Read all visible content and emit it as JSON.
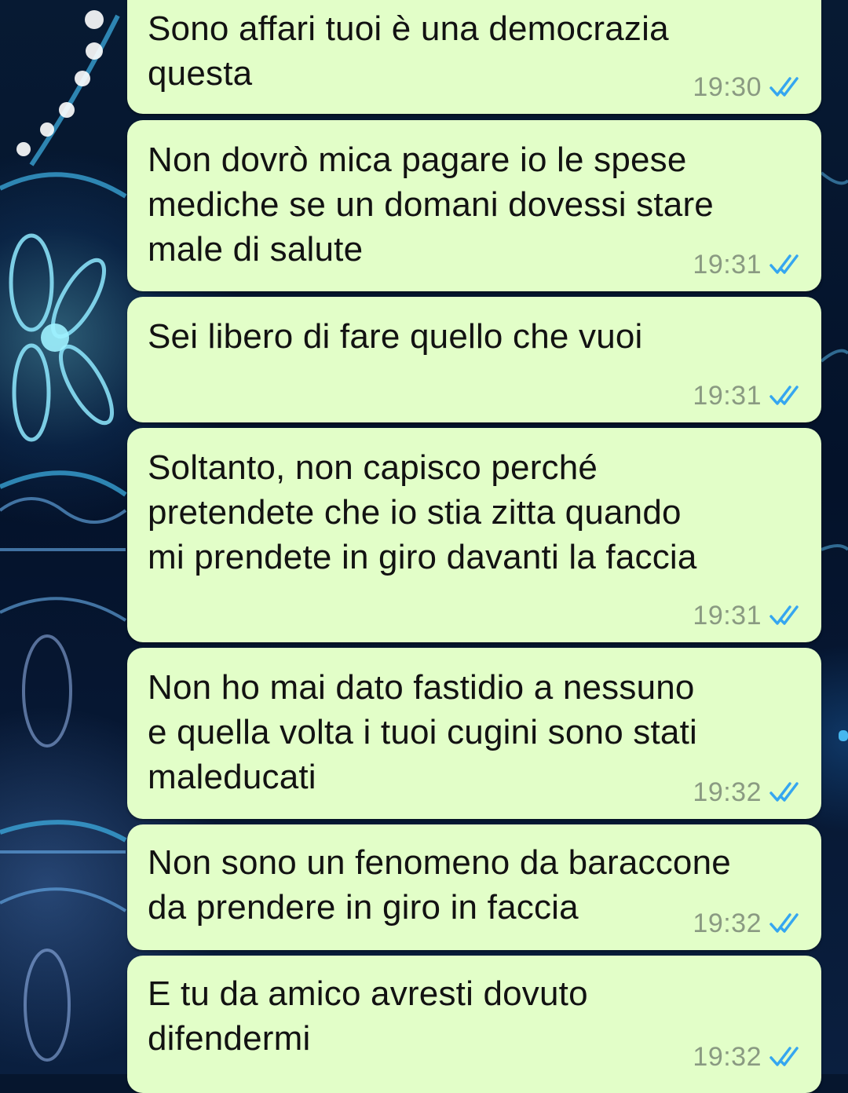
{
  "conversation": {
    "messages": [
      {
        "text": "Sono affari tuoi è una democrazia\nquesta",
        "time": "19:30",
        "status": "read"
      },
      {
        "text": "Non dovrò mica pagare io le spese\nmediche se un domani dovessi stare\nmale di salute",
        "time": "19:31",
        "status": "read"
      },
      {
        "text": "Sei libero di fare quello che vuoi",
        "time": "19:31",
        "status": "read"
      },
      {
        "text": "Soltanto, non capisco perché\npretendete che io stia zitta quando\nmi prendete in giro davanti la faccia",
        "time": "19:31",
        "status": "read"
      },
      {
        "text": "Non ho mai dato fastidio a nessuno\ne quella volta i tuoi cugini sono stati\nmaleducati",
        "time": "19:32",
        "status": "read"
      },
      {
        "text": "Non sono un fenomeno da baraccone\nda prendere in giro in faccia",
        "time": "19:32",
        "status": "read"
      },
      {
        "text": "E tu da amico avresti dovuto\ndifendermi",
        "time": "19:32",
        "status": "read"
      }
    ]
  },
  "colors": {
    "bubble_outgoing": "#e2fec8",
    "read_ticks": "#35a6f0",
    "timestamp": "#8a9a82",
    "wallpaper": "#06162e"
  },
  "icons": {
    "read_receipt": "double-check-icon"
  }
}
